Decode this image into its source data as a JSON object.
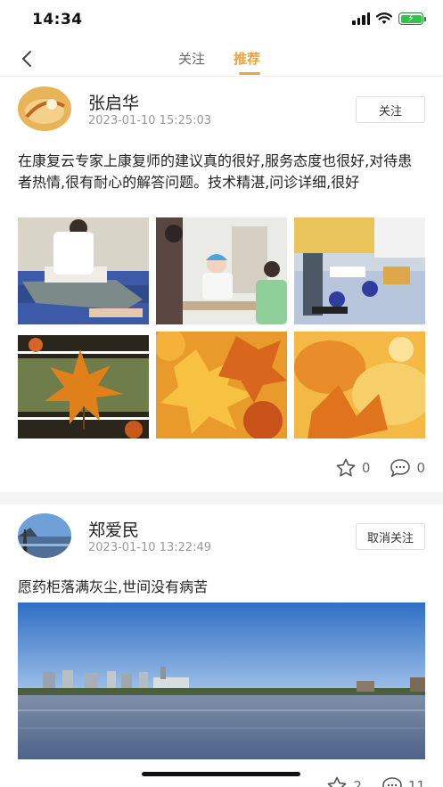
{
  "status_bar": {
    "time": "14:34"
  },
  "nav": {
    "tabs": [
      {
        "label": "关注"
      },
      {
        "label": "推荐"
      }
    ],
    "active_tab": "推荐"
  },
  "posts": [
    {
      "author": "张启华",
      "time": "2023-01-10 15:25:03",
      "follow_label": "关注",
      "text": "在康复云专家上康复师的建议真的很好,服务态度也很好,对待患者热情,很有耐心的解答问题。技术精湛,问诊详细,很好",
      "photos": [
        "rehab-therapy",
        "doctor-consultation",
        "rehab-equipment-room",
        "maple-leaf",
        "autumn-leaves",
        "autumn-leaves-closeup"
      ],
      "likes": "0",
      "comments": "0"
    },
    {
      "author": "郑爱民",
      "time": "2023-01-10 13:22:49",
      "follow_label": "取消关注",
      "text": "愿药柜落满灰尘,世间没有病苦",
      "photos": [
        "lake-city-skyline"
      ],
      "likes": "2",
      "comments": "11"
    }
  ],
  "colors": {
    "accent": "#f0a13a",
    "divider": "#f5f5f5"
  },
  "icons": {
    "back": "chevron-left-icon",
    "like": "star-icon",
    "comment": "comment-bubble-icon"
  }
}
